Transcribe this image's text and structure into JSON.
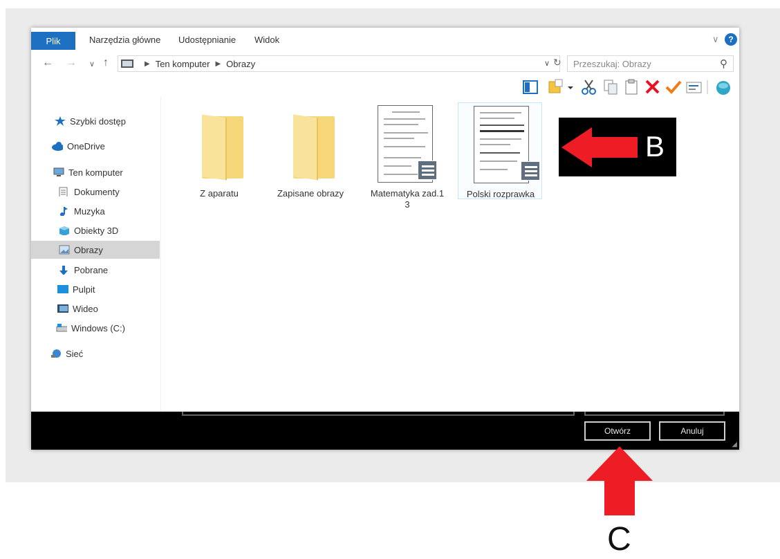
{
  "ribbon": {
    "file_tab": "Plik",
    "tabs": [
      "Narzędzia główne",
      "Udostępnianie",
      "Widok"
    ],
    "expand_glyph": "∨",
    "help_glyph": "?"
  },
  "nav": {
    "back_glyph": "←",
    "forward_glyph": "→",
    "recent_glyph": "∨",
    "up_glyph": "↑",
    "breadcrumb": [
      "Ten komputer",
      "Obrazy"
    ],
    "crumb_separator": "▶",
    "dropdown_glyph": "∨",
    "refresh_glyph": "↻",
    "search_placeholder": "Przeszukaj: Obrazy",
    "search_glyph": "⚲"
  },
  "toolbar": {
    "icons": [
      "view-pane-icon",
      "new-folder-icon",
      "dropdown-icon",
      "cut-icon",
      "copy-icon",
      "paste-icon",
      "delete-icon",
      "checkmark-icon",
      "properties-icon",
      "share-icon"
    ]
  },
  "sidebar": {
    "items": [
      {
        "label": "Szybki dostęp",
        "icon": "star-icon",
        "indent": false,
        "selected": false
      },
      {
        "label": "OneDrive",
        "icon": "cloud-icon",
        "indent": false,
        "selected": false
      },
      {
        "label": "Ten komputer",
        "icon": "computer-icon",
        "indent": false,
        "selected": false
      },
      {
        "label": "Dokumenty",
        "icon": "documents-icon",
        "indent": true,
        "selected": false
      },
      {
        "label": "Muzyka",
        "icon": "music-icon",
        "indent": true,
        "selected": false
      },
      {
        "label": "Obiekty 3D",
        "icon": "cube-3d-icon",
        "indent": true,
        "selected": false
      },
      {
        "label": "Obrazy",
        "icon": "pictures-icon",
        "indent": true,
        "selected": true
      },
      {
        "label": "Pobrane",
        "icon": "download-icon",
        "indent": true,
        "selected": false
      },
      {
        "label": "Pulpit",
        "icon": "desktop-icon",
        "indent": true,
        "selected": false
      },
      {
        "label": "Wideo",
        "icon": "video-icon",
        "indent": true,
        "selected": false
      },
      {
        "label": "Windows (C:)",
        "icon": "drive-icon",
        "indent": true,
        "selected": false
      },
      {
        "label": "Sieć",
        "icon": "network-icon",
        "indent": false,
        "selected": false
      }
    ]
  },
  "files": [
    {
      "name": "Z aparatu",
      "type": "folder",
      "selected": false
    },
    {
      "name": "Zapisane obrazy",
      "type": "folder",
      "selected": false
    },
    {
      "name": "Matematyka zad.1 3",
      "type": "document",
      "selected": false
    },
    {
      "name": "Polski rozprawka",
      "type": "document",
      "selected": true
    }
  ],
  "dialog": {
    "open_label": "Otwórz",
    "cancel_label": "Anuluj",
    "grip_glyph": "◢"
  },
  "annotations": {
    "b_label": "B",
    "c_label": "C",
    "arrow_color": "#ee1c24"
  },
  "colors": {
    "accent": "#1d6fc2",
    "folder": "#f5d77a",
    "selection": "#d5d5d5"
  }
}
